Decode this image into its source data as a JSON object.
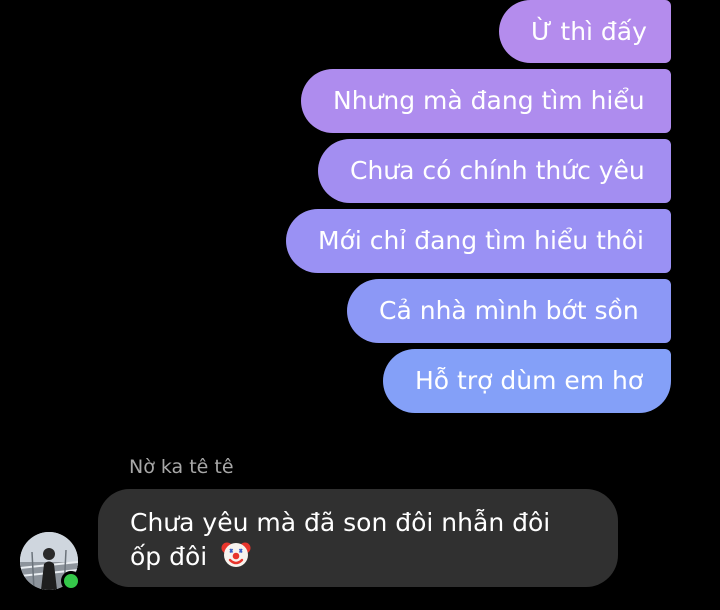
{
  "outgoing_messages": [
    {
      "text": "Ừ thì đấy"
    },
    {
      "text": "Nhưng mà đang tìm hiểu"
    },
    {
      "text": "Chưa có chính thức yêu"
    },
    {
      "text": "Mới chỉ đang tìm hiểu thôi"
    },
    {
      "text": "Cả nhà mình bớt sồn"
    },
    {
      "text": "Hỗ trợ dùm em hơ"
    }
  ],
  "incoming": {
    "sender_name": "Nờ ka tê tê",
    "text": "Chưa yêu mà đã son đôi nhẫn đôi ốp đôi",
    "emoji": "clown-face",
    "avatar_icon": "profile-photo",
    "online_status": "online"
  },
  "colors": {
    "background": "#000000",
    "outgoing_top": "#b48ced",
    "outgoing_bottom": "#84a0f8",
    "incoming_bubble": "#303030",
    "sender_name": "#a8a8a8",
    "online": "#35c84a"
  }
}
